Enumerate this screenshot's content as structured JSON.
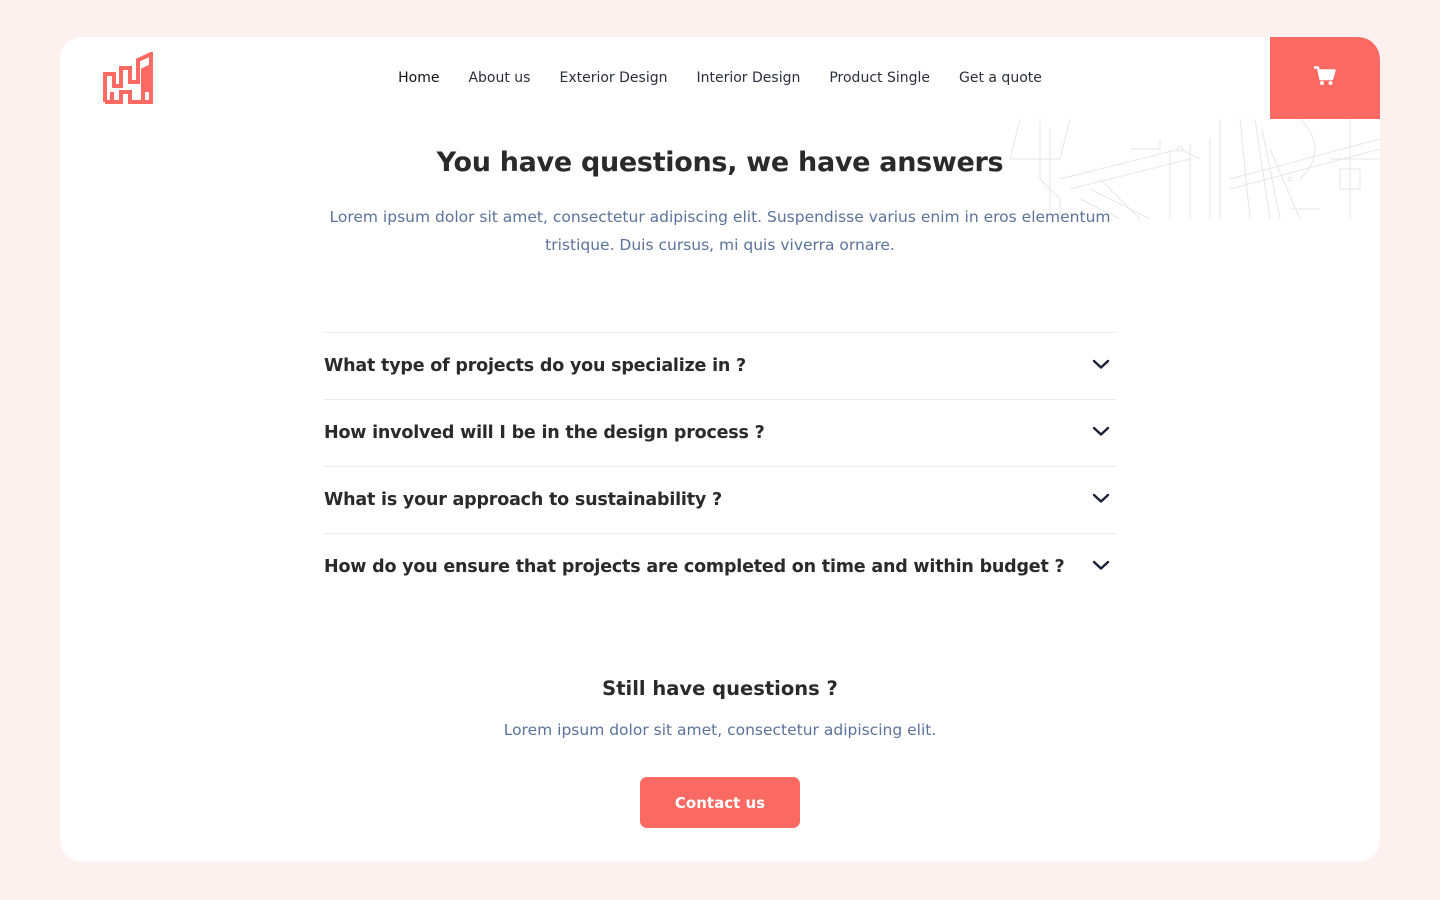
{
  "nav": {
    "items": [
      {
        "label": "Home"
      },
      {
        "label": "About us"
      },
      {
        "label": "Exterior Design"
      },
      {
        "label": "Interior Design"
      },
      {
        "label": "Product Single"
      },
      {
        "label": "Get a quote"
      }
    ],
    "active": "Home"
  },
  "hero": {
    "title": "You have questions, we have answers",
    "subtitle": "Lorem ipsum dolor sit amet, consectetur adipiscing elit. Suspendisse varius enim in eros elementum tristique. Duis cursus, mi quis viverra ornare."
  },
  "faq": {
    "items": [
      {
        "question": "What type of projects do you specialize in ?"
      },
      {
        "question": "How involved will I be in the design process ?"
      },
      {
        "question": "What is your approach to sustainability ?"
      },
      {
        "question": "How do you ensure that projects are completed on time and within budget ?"
      }
    ]
  },
  "cta": {
    "title": "Still have questions ?",
    "subtitle": "Lorem ipsum dolor sit amet, consectetur adipiscing elit.",
    "button_label": "Contact us"
  },
  "icons": {
    "logo": "building-logo-icon",
    "cart": "shopping-cart-icon",
    "chevron": "chevron-down-icon"
  },
  "colors": {
    "accent": "#fb6a62",
    "page_background": "#fdf1f0",
    "body_text": "#5b739b",
    "heading_text": "#2a2a2a"
  }
}
